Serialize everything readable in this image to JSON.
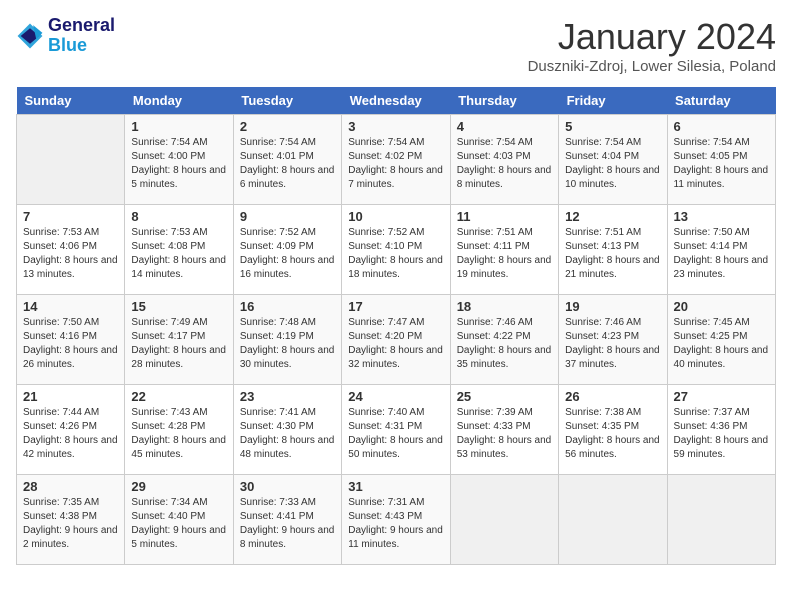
{
  "header": {
    "logo_line1": "General",
    "logo_line2": "Blue",
    "title": "January 2024",
    "subtitle": "Duszniki-Zdroj, Lower Silesia, Poland"
  },
  "weekdays": [
    "Sunday",
    "Monday",
    "Tuesday",
    "Wednesday",
    "Thursday",
    "Friday",
    "Saturday"
  ],
  "weeks": [
    [
      {
        "day": "",
        "sunrise": "",
        "sunset": "",
        "daylight": ""
      },
      {
        "day": "1",
        "sunrise": "Sunrise: 7:54 AM",
        "sunset": "Sunset: 4:00 PM",
        "daylight": "Daylight: 8 hours and 5 minutes."
      },
      {
        "day": "2",
        "sunrise": "Sunrise: 7:54 AM",
        "sunset": "Sunset: 4:01 PM",
        "daylight": "Daylight: 8 hours and 6 minutes."
      },
      {
        "day": "3",
        "sunrise": "Sunrise: 7:54 AM",
        "sunset": "Sunset: 4:02 PM",
        "daylight": "Daylight: 8 hours and 7 minutes."
      },
      {
        "day": "4",
        "sunrise": "Sunrise: 7:54 AM",
        "sunset": "Sunset: 4:03 PM",
        "daylight": "Daylight: 8 hours and 8 minutes."
      },
      {
        "day": "5",
        "sunrise": "Sunrise: 7:54 AM",
        "sunset": "Sunset: 4:04 PM",
        "daylight": "Daylight: 8 hours and 10 minutes."
      },
      {
        "day": "6",
        "sunrise": "Sunrise: 7:54 AM",
        "sunset": "Sunset: 4:05 PM",
        "daylight": "Daylight: 8 hours and 11 minutes."
      }
    ],
    [
      {
        "day": "7",
        "sunrise": "Sunrise: 7:53 AM",
        "sunset": "Sunset: 4:06 PM",
        "daylight": "Daylight: 8 hours and 13 minutes."
      },
      {
        "day": "8",
        "sunrise": "Sunrise: 7:53 AM",
        "sunset": "Sunset: 4:08 PM",
        "daylight": "Daylight: 8 hours and 14 minutes."
      },
      {
        "day": "9",
        "sunrise": "Sunrise: 7:52 AM",
        "sunset": "Sunset: 4:09 PM",
        "daylight": "Daylight: 8 hours and 16 minutes."
      },
      {
        "day": "10",
        "sunrise": "Sunrise: 7:52 AM",
        "sunset": "Sunset: 4:10 PM",
        "daylight": "Daylight: 8 hours and 18 minutes."
      },
      {
        "day": "11",
        "sunrise": "Sunrise: 7:51 AM",
        "sunset": "Sunset: 4:11 PM",
        "daylight": "Daylight: 8 hours and 19 minutes."
      },
      {
        "day": "12",
        "sunrise": "Sunrise: 7:51 AM",
        "sunset": "Sunset: 4:13 PM",
        "daylight": "Daylight: 8 hours and 21 minutes."
      },
      {
        "day": "13",
        "sunrise": "Sunrise: 7:50 AM",
        "sunset": "Sunset: 4:14 PM",
        "daylight": "Daylight: 8 hours and 23 minutes."
      }
    ],
    [
      {
        "day": "14",
        "sunrise": "Sunrise: 7:50 AM",
        "sunset": "Sunset: 4:16 PM",
        "daylight": "Daylight: 8 hours and 26 minutes."
      },
      {
        "day": "15",
        "sunrise": "Sunrise: 7:49 AM",
        "sunset": "Sunset: 4:17 PM",
        "daylight": "Daylight: 8 hours and 28 minutes."
      },
      {
        "day": "16",
        "sunrise": "Sunrise: 7:48 AM",
        "sunset": "Sunset: 4:19 PM",
        "daylight": "Daylight: 8 hours and 30 minutes."
      },
      {
        "day": "17",
        "sunrise": "Sunrise: 7:47 AM",
        "sunset": "Sunset: 4:20 PM",
        "daylight": "Daylight: 8 hours and 32 minutes."
      },
      {
        "day": "18",
        "sunrise": "Sunrise: 7:46 AM",
        "sunset": "Sunset: 4:22 PM",
        "daylight": "Daylight: 8 hours and 35 minutes."
      },
      {
        "day": "19",
        "sunrise": "Sunrise: 7:46 AM",
        "sunset": "Sunset: 4:23 PM",
        "daylight": "Daylight: 8 hours and 37 minutes."
      },
      {
        "day": "20",
        "sunrise": "Sunrise: 7:45 AM",
        "sunset": "Sunset: 4:25 PM",
        "daylight": "Daylight: 8 hours and 40 minutes."
      }
    ],
    [
      {
        "day": "21",
        "sunrise": "Sunrise: 7:44 AM",
        "sunset": "Sunset: 4:26 PM",
        "daylight": "Daylight: 8 hours and 42 minutes."
      },
      {
        "day": "22",
        "sunrise": "Sunrise: 7:43 AM",
        "sunset": "Sunset: 4:28 PM",
        "daylight": "Daylight: 8 hours and 45 minutes."
      },
      {
        "day": "23",
        "sunrise": "Sunrise: 7:41 AM",
        "sunset": "Sunset: 4:30 PM",
        "daylight": "Daylight: 8 hours and 48 minutes."
      },
      {
        "day": "24",
        "sunrise": "Sunrise: 7:40 AM",
        "sunset": "Sunset: 4:31 PM",
        "daylight": "Daylight: 8 hours and 50 minutes."
      },
      {
        "day": "25",
        "sunrise": "Sunrise: 7:39 AM",
        "sunset": "Sunset: 4:33 PM",
        "daylight": "Daylight: 8 hours and 53 minutes."
      },
      {
        "day": "26",
        "sunrise": "Sunrise: 7:38 AM",
        "sunset": "Sunset: 4:35 PM",
        "daylight": "Daylight: 8 hours and 56 minutes."
      },
      {
        "day": "27",
        "sunrise": "Sunrise: 7:37 AM",
        "sunset": "Sunset: 4:36 PM",
        "daylight": "Daylight: 8 hours and 59 minutes."
      }
    ],
    [
      {
        "day": "28",
        "sunrise": "Sunrise: 7:35 AM",
        "sunset": "Sunset: 4:38 PM",
        "daylight": "Daylight: 9 hours and 2 minutes."
      },
      {
        "day": "29",
        "sunrise": "Sunrise: 7:34 AM",
        "sunset": "Sunset: 4:40 PM",
        "daylight": "Daylight: 9 hours and 5 minutes."
      },
      {
        "day": "30",
        "sunrise": "Sunrise: 7:33 AM",
        "sunset": "Sunset: 4:41 PM",
        "daylight": "Daylight: 9 hours and 8 minutes."
      },
      {
        "day": "31",
        "sunrise": "Sunrise: 7:31 AM",
        "sunset": "Sunset: 4:43 PM",
        "daylight": "Daylight: 9 hours and 11 minutes."
      },
      {
        "day": "",
        "sunrise": "",
        "sunset": "",
        "daylight": ""
      },
      {
        "day": "",
        "sunrise": "",
        "sunset": "",
        "daylight": ""
      },
      {
        "day": "",
        "sunrise": "",
        "sunset": "",
        "daylight": ""
      }
    ]
  ]
}
